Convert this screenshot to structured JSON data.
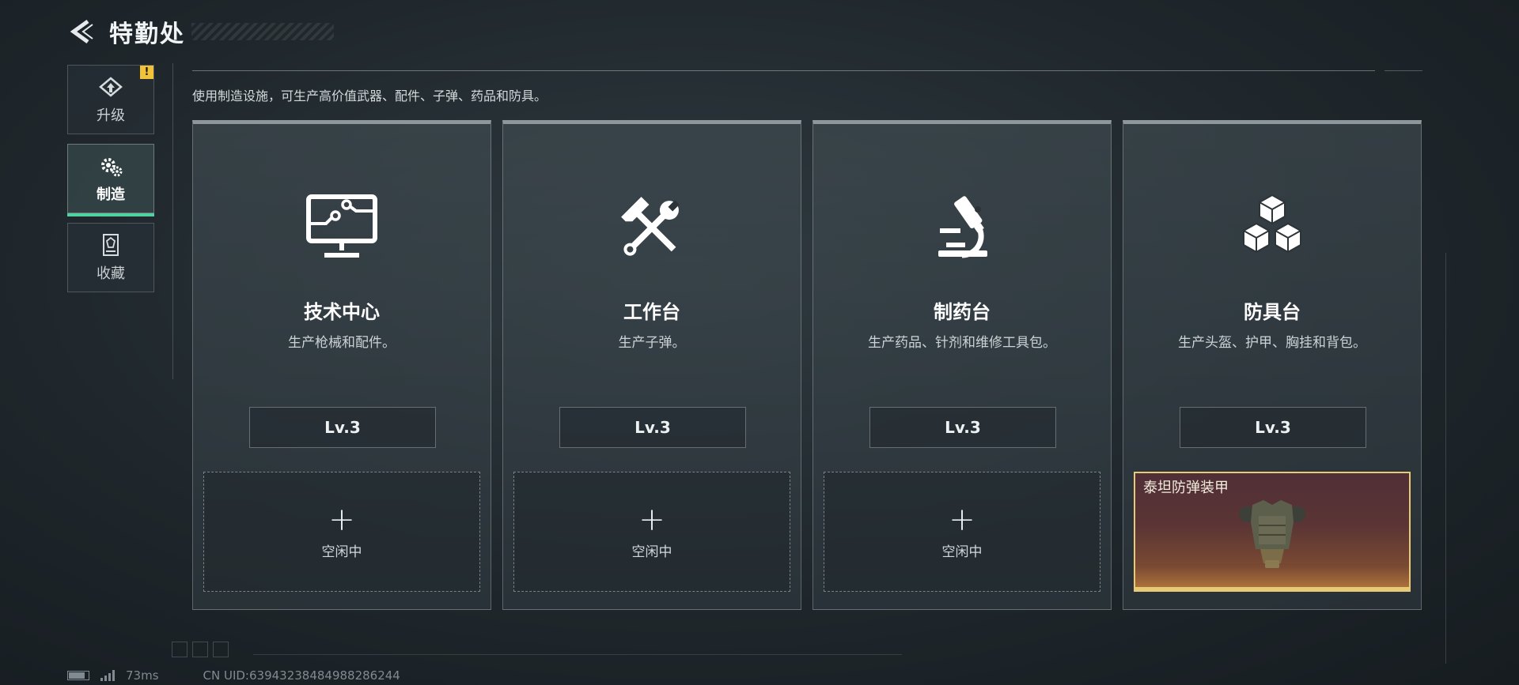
{
  "header": {
    "title": "特勤处"
  },
  "sidebar": {
    "items": [
      {
        "label": "升级",
        "icon": "upgrade-icon",
        "badge": "!"
      },
      {
        "label": "制造",
        "icon": "gear-cog-icon",
        "active": true
      },
      {
        "label": "收藏",
        "icon": "collection-icon"
      }
    ]
  },
  "description": "使用制造设施，可生产高价值武器、配件、子弹、药品和防具。",
  "cards": [
    {
      "name": "技术中心",
      "subtitle": "生产枪械和配件。",
      "level": "Lv.3",
      "icon": "monitor-circuit-icon",
      "slot": {
        "plus": "+",
        "status": "空闲中"
      }
    },
    {
      "name": "工作台",
      "subtitle": "生产子弹。",
      "level": "Lv.3",
      "icon": "hammer-wrench-icon",
      "slot": {
        "plus": "+",
        "status": "空闲中"
      }
    },
    {
      "name": "制药台",
      "subtitle": "生产药品、针剂和维修工具包。",
      "level": "Lv.3",
      "icon": "microscope-icon",
      "slot": {
        "plus": "+",
        "status": "空闲中"
      }
    },
    {
      "name": "防具台",
      "subtitle": "生产头盔、护甲、胸挂和背包。",
      "level": "Lv.3",
      "icon": "cubes-icon",
      "slot": {
        "item_name": "泰坦防弹装甲",
        "item_icon": "armor-vest-icon"
      }
    }
  ],
  "footer": {
    "ping": "73ms",
    "uid": "CN UID:63943238484988286244"
  },
  "colors": {
    "accent_green": "#4fd2a0",
    "badge_yellow": "#f0c23a",
    "item_border_gold": "#e8c976"
  }
}
